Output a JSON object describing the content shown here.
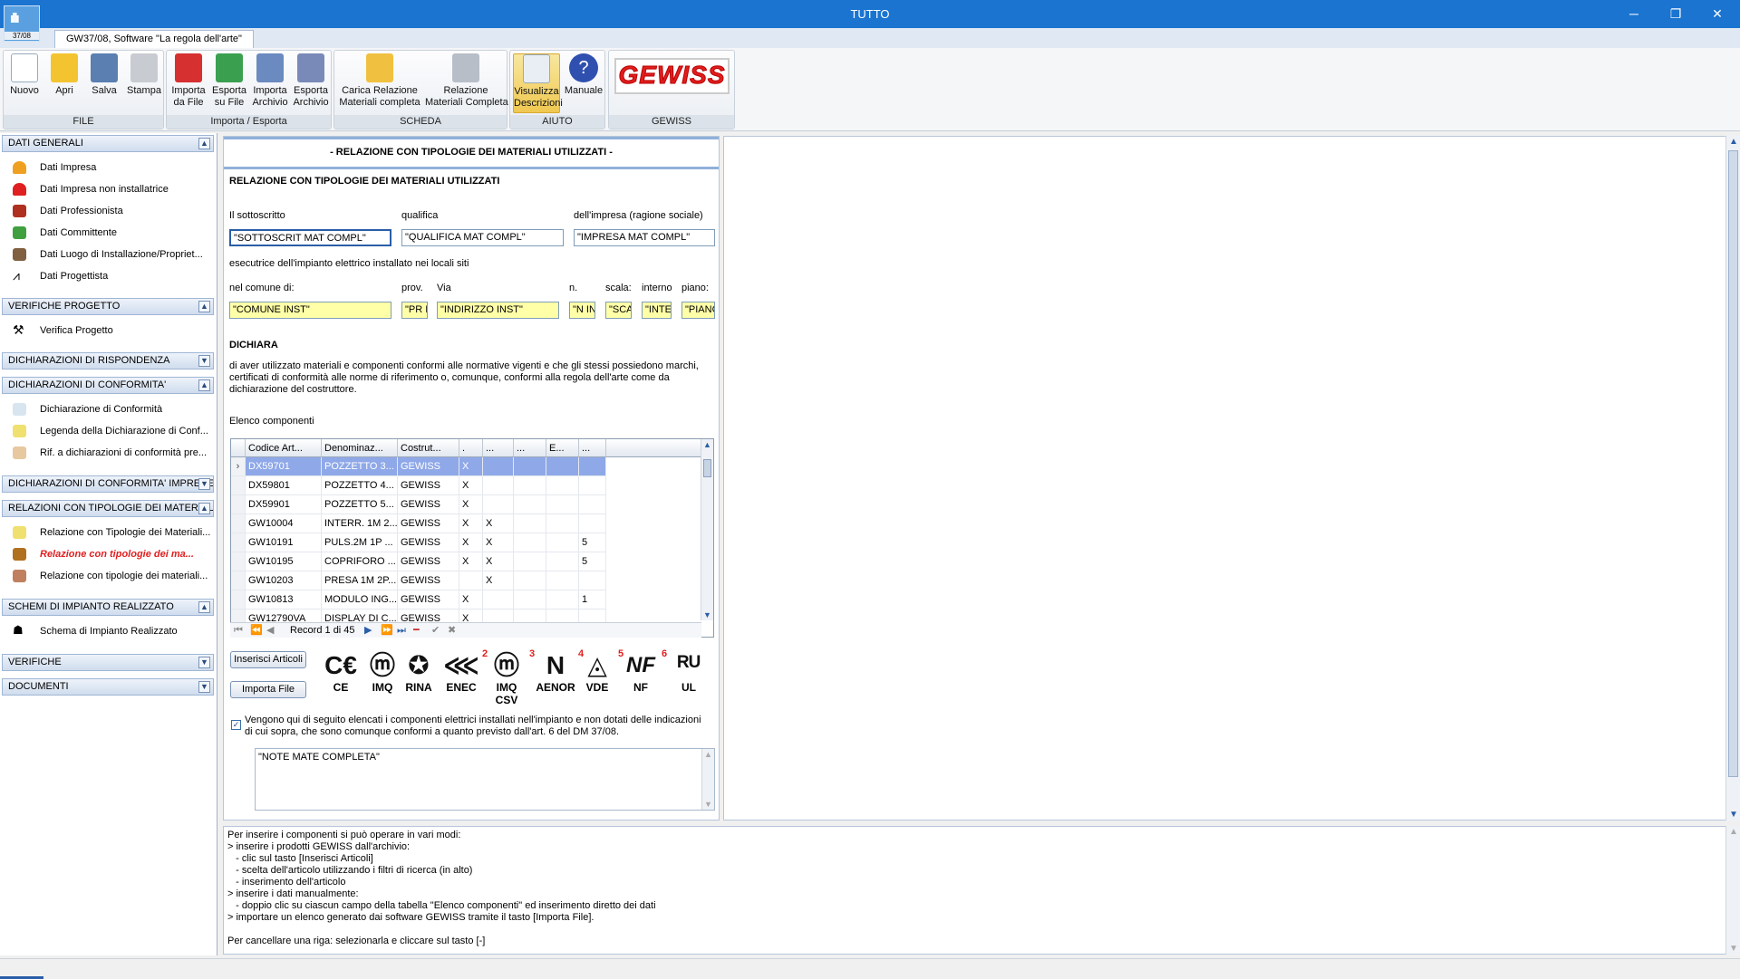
{
  "window": {
    "title": "TUTTO"
  },
  "app_icon": {
    "label": "37/08"
  },
  "doc_tab": {
    "label": "GW37/08, Software \"La regola dell'arte\""
  },
  "ribbon": {
    "groups": [
      "FILE",
      "Importa / Esporta",
      "SCHEDA",
      "AIUTO",
      "GEWISS"
    ],
    "buttons": [
      "Nuovo",
      "Apri",
      "Salva",
      "Stampa",
      "Importa\nda File",
      "Esporta\nsu File",
      "Importa\nArchivio",
      "Esporta\nArchivio",
      "Carica Relazione\nMateriali completa",
      "Relazione\nMateriali Completa",
      "Visualizza\nDescrizioni",
      "Manuale"
    ],
    "logo": "GEWISS"
  },
  "sidebar": {
    "sections": [
      {
        "title": "DATI GENERALI",
        "chev": "▲",
        "items": [
          "Dati Impresa",
          "Dati Impresa non installatrice",
          "Dati Professionista",
          "Dati Committente",
          "Dati Luogo di Installazione/Propriet...",
          "Dati Progettista"
        ]
      },
      {
        "title": "VERIFICHE PROGETTO",
        "chev": "▲",
        "items": [
          "Verifica Progetto"
        ]
      },
      {
        "title": "DICHIARAZIONI DI RISPONDENZA",
        "chev": "▼",
        "items": []
      },
      {
        "title": "DICHIARAZIONI DI CONFORMITA'",
        "chev": "▲",
        "items": [
          "Dichiarazione di Conformità",
          "Legenda della Dichiarazione di Conf...",
          "Rif. a dichiarazioni di conformità pre..."
        ]
      },
      {
        "title": "DICHIARAZIONI DI CONFORMITA' IMPRESE",
        "chev": "▼",
        "items": []
      },
      {
        "title": "RELAZIONI CON TIPOLOGIE DEI MATERIALI",
        "chev": "▲",
        "items": [
          "Relazione con Tipologie dei Materiali...",
          "Relazione con tipologie dei ma...",
          "Relazione con tipologie dei materiali..."
        ]
      },
      {
        "title": "SCHEMI DI IMPIANTO REALIZZATO",
        "chev": "▲",
        "items": [
          "Schema di Impianto Realizzato"
        ]
      },
      {
        "title": "VERIFICHE",
        "chev": "▼",
        "items": []
      },
      {
        "title": "DOCUMENTI",
        "chev": "▼",
        "items": []
      }
    ]
  },
  "form": {
    "header": "- RELAZIONE CON TIPOLOGIE DEI MATERIALI UTILIZZATI -",
    "heading": "RELAZIONE CON TIPOLOGIE DEI MATERIALI UTILIZZATI",
    "labels": {
      "sottoscritto": "Il sottoscritto",
      "qualifica": "qualifica",
      "impresa": "dell'impresa (ragione sociale)",
      "esecutrice": "esecutrice dell'impianto elettrico installato nei locali siti",
      "comune": "nel comune di:",
      "prov": "prov.",
      "via": "Via",
      "n": "n.",
      "scala": "scala:",
      "interno": "interno",
      "piano": "piano:",
      "dichiara": "DICHIARA",
      "dichiara_text": "di aver utilizzato materiali e componenti conformi alle normative vigenti e che gli stessi possiedono marchi,\ncertificati di conformità alle norme di riferimento o, comunque, conformi alla regola dell'arte come da\ndichiarazione del costruttore.",
      "elenco": "Elenco componenti"
    },
    "values": {
      "sottoscritto": "\"SOTTOSCRIT MAT COMPL\"",
      "qualifica": "\"QUALIFICA MAT COMPL\"",
      "impresa": "\"IMPRESA MAT COMPL\"",
      "comune": "\"COMUNE INST\"",
      "prov": "\"PR I",
      "via": "\"INDIRIZZO INST\"",
      "n": "\"N IN",
      "scala": "\"SCA",
      "interno": "\"INTE",
      "piano": "\"PIANC"
    },
    "checkbox_text": "Vengono qui di seguito elencati i componenti elettrici installati nell'impianto e non dotati delle indicazioni\ndi cui sopra, che sono comunque conformi a quanto previsto dall'art. 6 del DM 37/08.",
    "notes": "\"NOTE MATE COMPLETA\"",
    "buttons": {
      "inserisci": "Inserisci Articoli",
      "importa": "Importa File"
    }
  },
  "table": {
    "columns": [
      "Codice Art...",
      "Denominaz...",
      "Costrut...",
      ".",
      "...",
      "...",
      "E...",
      "..."
    ],
    "rows": [
      [
        "DX59701",
        "POZZETTO 3...",
        "GEWISS",
        "X",
        "",
        "",
        "",
        ""
      ],
      [
        "DX59801",
        "POZZETTO 4...",
        "GEWISS",
        "X",
        "",
        "",
        "",
        ""
      ],
      [
        "DX59901",
        "POZZETTO 5...",
        "GEWISS",
        "X",
        "",
        "",
        "",
        ""
      ],
      [
        "GW10004",
        "INTERR. 1M 2...",
        "GEWISS",
        "X",
        "X",
        "",
        "",
        ""
      ],
      [
        "GW10191",
        "PULS.2M 1P ...",
        "GEWISS",
        "X",
        "X",
        "",
        "",
        "5"
      ],
      [
        "GW10195",
        "COPRIFORO ...",
        "GEWISS",
        "X",
        "X",
        "",
        "",
        "5"
      ],
      [
        "GW10203",
        "PRESA 1M 2P...",
        "GEWISS",
        "",
        "X",
        "",
        "",
        ""
      ],
      [
        "GW10813",
        "MODULO ING...",
        "GEWISS",
        "X",
        "",
        "",
        "",
        "1"
      ],
      [
        "GW12790VA",
        "DISPLAY DI C...",
        "GEWISS",
        "X",
        "",
        "",
        "",
        ""
      ]
    ],
    "record_text": "Record 1 di 45"
  },
  "certs": [
    {
      "label": "CE",
      "num": "",
      "sym": "C€"
    },
    {
      "label": "IMQ",
      "num": "",
      "sym": "ⓜ"
    },
    {
      "label": "RINA",
      "num": "",
      "sym": "✪"
    },
    {
      "label": "ENEC",
      "num": "",
      "sym": "⋘"
    },
    {
      "label": "IMQ CSV",
      "num": "2",
      "sym": "ⓜ"
    },
    {
      "label": "AENOR",
      "num": "3",
      "sym": "Ν"
    },
    {
      "label": "VDE",
      "num": "4",
      "sym": "◬"
    },
    {
      "label": "NF",
      "num": "5",
      "sym": "NF"
    },
    {
      "label": "UL",
      "num": "6",
      "sym": "ᴿᵁ"
    }
  ],
  "help_text": "Per inserire i componenti si può operare in vari modi:\n> inserire i prodotti GEWISS dall'archivio:\n   - clic sul tasto [Inserisci Articoli]\n   - scelta dell'articolo utilizzando i filtri di ricerca (in alto)\n   - inserimento dell'articolo\n> inserire i dati manualmente:\n   - doppio clic su ciascun campo della tabella \"Elenco componenti\" ed inserimento diretto dei dati\n> importare un elenco generato dai software GEWISS tramite il tasto [Importa File].\n\nPer cancellare una riga: selezionarla e cliccare sul tasto [-]",
  "colors": {
    "titlebar": "#1a74d0",
    "accent_red": "#e02020",
    "selection": "#8fa8e8"
  }
}
